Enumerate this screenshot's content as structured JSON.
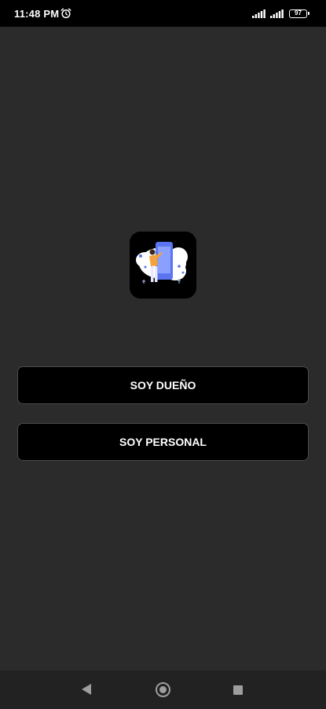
{
  "status_bar": {
    "time": "11:48 PM",
    "battery_level": "97",
    "icons": [
      "alarm-icon",
      "signal-icon",
      "signal-icon",
      "battery-icon"
    ]
  },
  "app": {
    "logo_icon": "phone-person-illustration-icon"
  },
  "buttons": {
    "owner_label": "SOY DUEÑO",
    "staff_label": "SOY PERSONAL"
  },
  "nav_bar": {
    "icons": [
      "back-icon",
      "home-icon",
      "recents-icon"
    ]
  },
  "colors": {
    "background": "#2b2b2b",
    "button_background": "#000000",
    "accent_orange": "#f2a33c",
    "accent_blue": "#5b74f0",
    "text": "#ffffff"
  }
}
